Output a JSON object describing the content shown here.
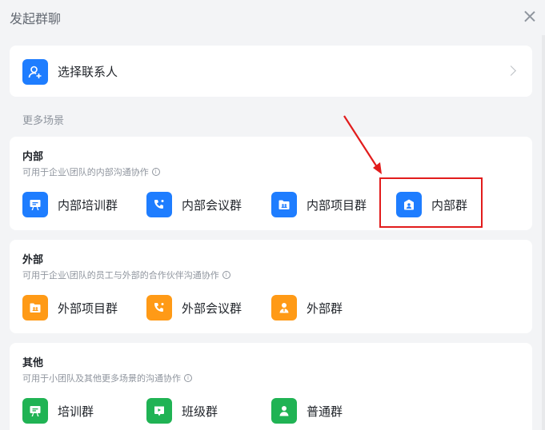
{
  "dialog": {
    "title": "发起群聊"
  },
  "contact": {
    "label": "选择联系人",
    "icon": "add-contact-icon"
  },
  "more_scenes_label": "更多场景",
  "sections": [
    {
      "title": "内部",
      "subtitle": "可用于企业\\团队的内部沟通协作",
      "options": [
        {
          "label": "内部培训群",
          "icon": "training-icon",
          "color": "#1e7dff"
        },
        {
          "label": "内部会议群",
          "icon": "meeting-icon",
          "color": "#1e7dff"
        },
        {
          "label": "内部项目群",
          "icon": "project-folder-icon",
          "color": "#1e7dff"
        },
        {
          "label": "内部群",
          "icon": "internal-group-icon",
          "color": "#1e7dff"
        }
      ]
    },
    {
      "title": "外部",
      "subtitle": "可用于企业\\团队的员工与外部的合作伙伴沟通协作",
      "options": [
        {
          "label": "外部项目群",
          "icon": "project-folder-icon",
          "color": "#ff9a16"
        },
        {
          "label": "外部会议群",
          "icon": "meeting-icon",
          "color": "#ff9a16"
        },
        {
          "label": "外部群",
          "icon": "external-group-icon",
          "color": "#ff9a16"
        }
      ]
    },
    {
      "title": "其他",
      "subtitle": "可用于小团队及其他更多场景的沟通协作",
      "options": [
        {
          "label": "培训群",
          "icon": "training-icon",
          "color": "#20b354"
        },
        {
          "label": "班级群",
          "icon": "class-icon",
          "color": "#20b354"
        },
        {
          "label": "普通群",
          "icon": "person-icon",
          "color": "#20b354"
        }
      ]
    }
  ],
  "annotation": {
    "highlight_color": "#e21c1c"
  }
}
